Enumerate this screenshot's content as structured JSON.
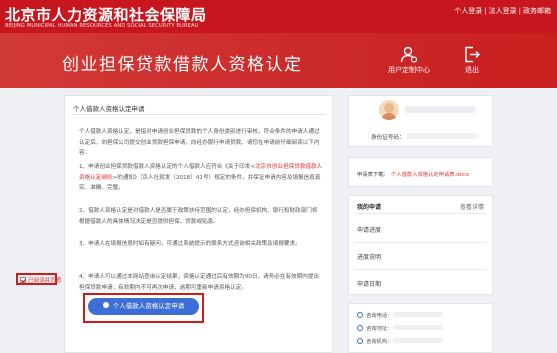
{
  "header": {
    "logo_cn": "北京市人力资源和社会保障局",
    "logo_en": "BEIJING MUNICIPAL HUMAN RESOURCES AND SOCIAL SECURITY BUREAU",
    "links": [
      "个人登录",
      "法人登录",
      "政务邮箱"
    ],
    "separator": "|"
  },
  "banner": {
    "title": "创业担保贷款借款人资格认定",
    "user_center_label": "用户定制中心",
    "exit_label": "退出"
  },
  "application": {
    "heading": "个人借款人资格认定申请",
    "paragraphs": [
      "个人借款人资格认定，是指对申请创业担保贷款的个人身份类别进行审核，符合条件的申请人通过认定后，向担保公司提交创业贷款担保申请，向经办银行申请贷款。请您在申请前仔细阅读以下内容：",
      "1、申请创业担保贷款借款人资格认定的个人借款人应符合《关于印发<北京市创业担保贷款借款人资格认定细则>的通知》（京人社就发〔2018〕41号）规定的条件，并保证申请内容及填报信息真实、准确、完整。",
      "2、借款人资格认定是对借款人是否属于政策扶持范围的认定，经办担保机构、银行和财政部门将根据借款人的具体情况决定是否提供担保、贷款或贴息。",
      "3、申请人在填报信息时如有疑问，可通过系统提示的联系方式咨询相关政策及填报要求。",
      "4、申请人可以通过本网站查询认定结果，资格认定通过后有效期为90日，请务必在有效期内提出担保贷款申请，有效期内不可再次申请，逾期可重新申请资格认定。"
    ],
    "p1_link_text": "北京市创业担保贷款借款人资格认定细则",
    "agree_label": "已阅读并同意",
    "apply_button": "个人借款人资格认定申请"
  },
  "profile": {
    "id_label": "身份证号码："
  },
  "download": {
    "label": "申请表下载：",
    "link": "个人借款人资格认定申请表.docx"
  },
  "status": {
    "heading": "我的申请",
    "more": "查看详情",
    "items": [
      "申请进度",
      "进度说明",
      "申请日期"
    ]
  },
  "contact": {
    "phone_label": "咨询电话：",
    "address_label": "咨询地址：",
    "org_label": "咨询机构："
  },
  "colors": {
    "brand_red": "#c8161e",
    "button_blue": "#3c6ed6"
  }
}
